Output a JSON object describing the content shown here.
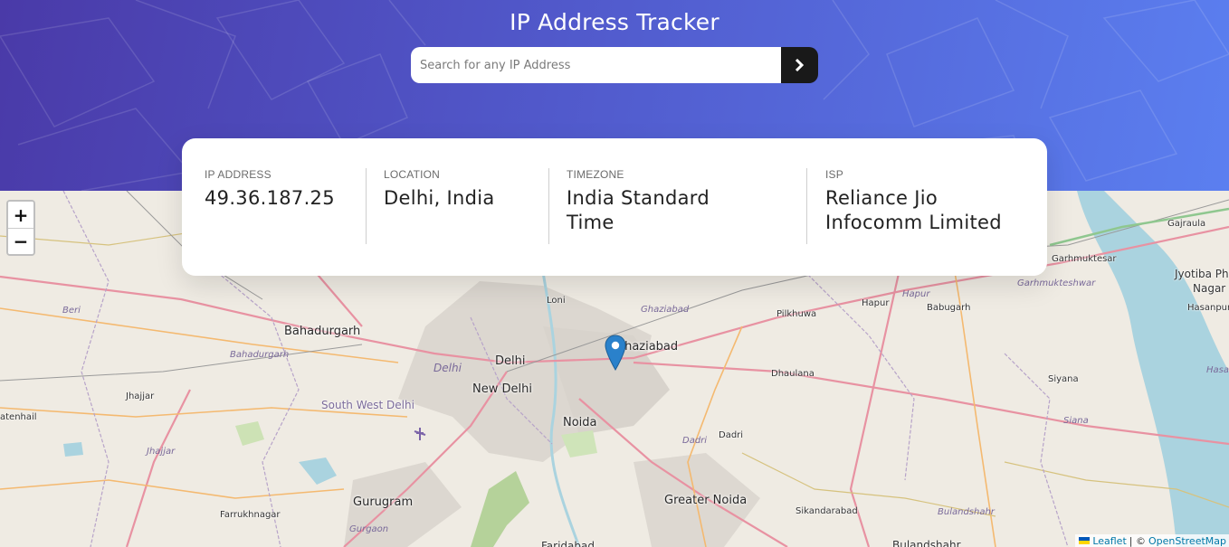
{
  "header": {
    "title": "IP Address Tracker",
    "search": {
      "placeholder": "Search for any IP Address",
      "value": "",
      "submit_icon": "chevron-right-icon"
    }
  },
  "info": {
    "ip": {
      "label": "IP ADDRESS",
      "value": "49.36.187.25"
    },
    "location": {
      "label": "LOCATION",
      "value": "Delhi, India"
    },
    "timezone": {
      "label": "TIMEZONE",
      "value": "India Standard Time"
    },
    "isp": {
      "label": "ISP",
      "value": "Reliance Jio Infocomm Limited"
    }
  },
  "map": {
    "zoom_in": "+",
    "zoom_out": "−",
    "marker_icon": "map-pin-icon",
    "labels": {
      "delhi": "Delhi",
      "new_delhi": "New Delhi",
      "noida": "Noida",
      "ghaziabad": "Ghaziabad",
      "gurugram": "Gurugram",
      "greater_noida": "Greater Noida",
      "bahadurgarh": "Bahadurgarh",
      "south_west_delhi": "South West Delhi",
      "jhajjar": "Jhajjar",
      "jhajjar_dist": "Jhajjar",
      "bahadurgarh_dist": "Bahadurgarh",
      "beri": "Beri",
      "atenhail": "atenhail",
      "farrukhnagar": "Farrukhnagar",
      "gurgaon_dist": "Gurgaon",
      "loni": "Loni",
      "ghaziabad_dist": "Ghaziabad",
      "delhi_dist": "Delhi",
      "pilkhuwa": "Pilkhuwa",
      "dhaulana": "Dhaulana",
      "dadri": "Dadri",
      "dadri_dist": "Dadri",
      "hapur": "Hapur",
      "hapur_dist": "Hapur",
      "babugarh": "Babugarh",
      "garhmuktesar": "Garhmuktesar",
      "garhmukteshwar_dist": "Garhmukteshwar",
      "gajraula": "Gajraula",
      "jyotiba": "Jyotiba Phu",
      "nagar": "Nagar",
      "hasanpur": "Hasanpur",
      "hasa": "Hasa",
      "siyana": "Siyana",
      "siana_dist": "Siana",
      "sikandarabad": "Sikandarabad",
      "bulandshahr_dist": "Bulandshahr",
      "bulandshahr": "Bulandshahr",
      "faridabad": "Faridabad"
    },
    "attribution": {
      "leaflet": "Leaflet",
      "separator": "| ©",
      "osm": "OpenStreetMap"
    }
  },
  "colors": {
    "header_gradient_start": "#4a3aa8",
    "header_gradient_end": "#5b7ff0",
    "search_button": "#191919",
    "marker": "#2a81cb"
  }
}
